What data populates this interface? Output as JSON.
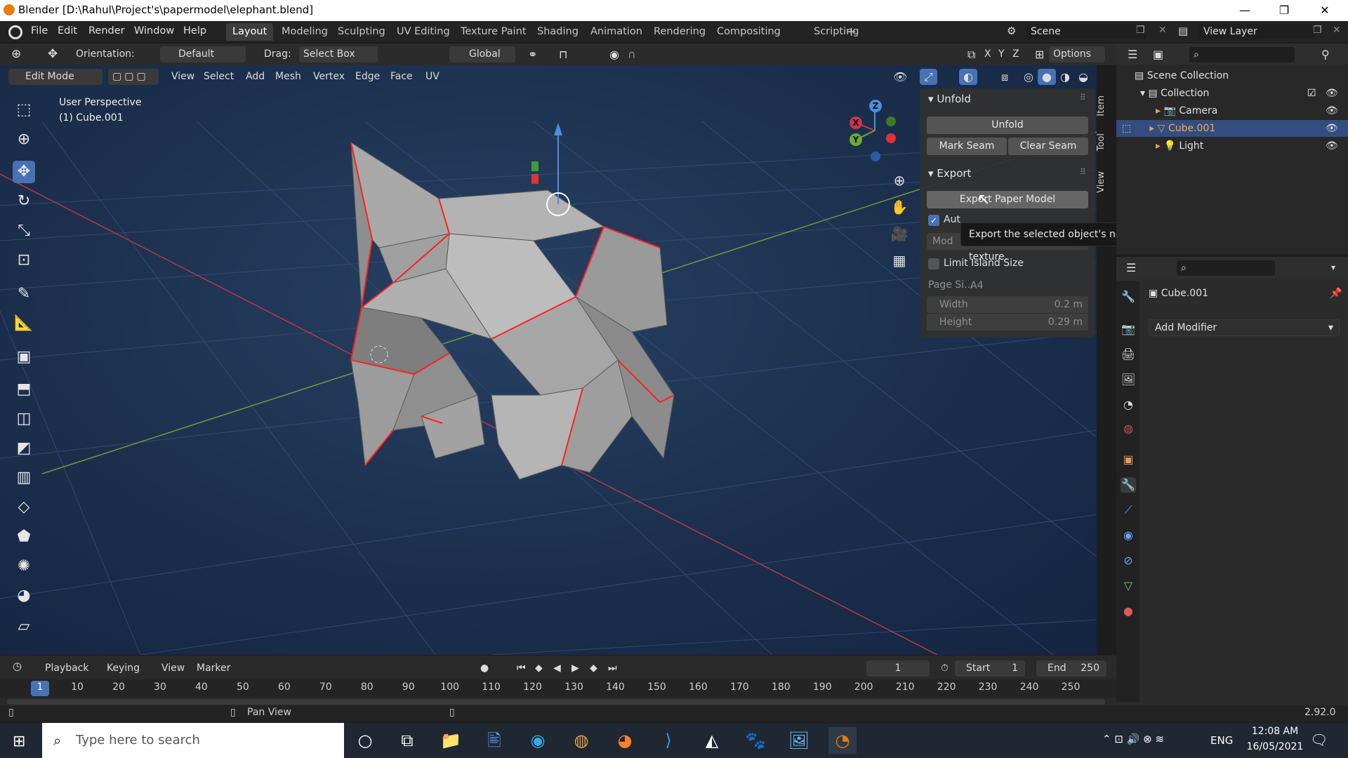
{
  "titlebar": {
    "title": "Blender [D:\\Rahul\\Project's\\papermodel\\elephant.blend]",
    "minimize": "—",
    "restore": "❐",
    "close": "✕"
  },
  "menu": {
    "items": [
      "File",
      "Edit",
      "Render",
      "Window",
      "Help"
    ]
  },
  "workspaces": [
    "Layout",
    "Modeling",
    "Sculpting",
    "UV Editing",
    "Texture Paint",
    "Shading",
    "Animation",
    "Rendering",
    "Compositing",
    "Scripting"
  ],
  "workspace_add": "+",
  "scene": {
    "name": "Scene",
    "view_layer": "View Layer"
  },
  "toolheader": {
    "orientation_label": "Orientation:",
    "orientation_value": "Default",
    "drag_label": "Drag:",
    "drag_value": "Select Box",
    "transform_value": "Global",
    "options": "Options",
    "axes": [
      "X",
      "Y",
      "Z"
    ]
  },
  "modeheader": {
    "mode": "Edit Mode",
    "menus": [
      "View",
      "Select",
      "Add",
      "Mesh",
      "Vertex",
      "Edge",
      "Face",
      "UV"
    ]
  },
  "viewport": {
    "perspective": "User Perspective",
    "object": "(1) Cube.001"
  },
  "npanel": {
    "unfold_header": "Unfold",
    "unfold_button": "Unfold",
    "mark_seam": "Mark Seam",
    "clear_seam": "Clear Seam",
    "export_header": "Export",
    "export_button": "Export Paper Model",
    "auto_scale_label": "Aut",
    "auto_scale_checked": true,
    "model_label": "Mod",
    "limit_island": "Limit Island Size",
    "limit_island_checked": false,
    "page_size_label": "Page Si...",
    "page_size_value": "A4",
    "width_label": "Width",
    "width_value": "0.2 m",
    "height_label": "Height",
    "height_value": "0.29 m",
    "tabs": [
      "Item",
      "Tool",
      "View"
    ]
  },
  "tooltip": "Export the selected object's net and optionally bake its texture.",
  "gizmo": {
    "x": "X",
    "y": "Y",
    "z": "Z"
  },
  "outliner": {
    "scene_collection": "Scene Collection",
    "collection": "Collection",
    "items": [
      {
        "name": "Camera",
        "selected": false
      },
      {
        "name": "Cube.001",
        "selected": true
      },
      {
        "name": "Light",
        "selected": false
      }
    ]
  },
  "properties": {
    "object": "Cube.001",
    "add_modifier": "Add Modifier"
  },
  "timeline": {
    "menus": [
      "Playback",
      "Keying",
      "View",
      "Marker"
    ],
    "current_frame": "1",
    "start_label": "Start",
    "start_value": "1",
    "end_label": "End",
    "end_value": "250",
    "ticks": [
      "1",
      "10",
      "20",
      "30",
      "40",
      "50",
      "60",
      "70",
      "80",
      "90",
      "100",
      "110",
      "120",
      "130",
      "140",
      "150",
      "160",
      "170",
      "180",
      "190",
      "200",
      "210",
      "220",
      "230",
      "240",
      "250"
    ]
  },
  "statusbar": {
    "hint": "Pan View",
    "version": "2.92.0"
  },
  "taskbar": {
    "search_placeholder": "Type here to search",
    "language": "ENG",
    "time": "12:08 AM",
    "date": "16/05/2021"
  },
  "colors": {
    "accent": "#4772b3",
    "seam": "#ff2020",
    "selected_text": "#f3a94c",
    "blender_orange": "#e87d0d"
  }
}
